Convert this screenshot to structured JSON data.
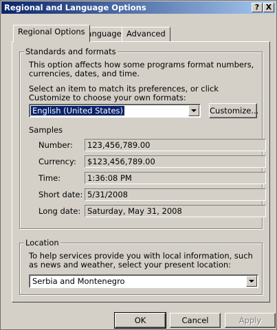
{
  "window": {
    "title": "Regional and Language Options",
    "help_label": "?",
    "close_label": "X"
  },
  "tabs": [
    {
      "label": "Regional Options",
      "active": true
    },
    {
      "label": "Languages",
      "active": false
    },
    {
      "label": "Advanced",
      "active": false
    }
  ],
  "standards": {
    "group_title": "Standards and formats",
    "description": "This option affects how some programs format numbers, currencies, dates, and time.",
    "instruction": "Select an item to match its preferences, or click Customize to choose your own formats:",
    "selected_format": "English (United States)",
    "customize_label": "Customize..."
  },
  "samples": {
    "title": "Samples",
    "rows": [
      {
        "label": "Number:",
        "value": "123,456,789.00"
      },
      {
        "label": "Currency:",
        "value": "$123,456,789.00"
      },
      {
        "label": "Time:",
        "value": "1:36:08 PM"
      },
      {
        "label": "Short date:",
        "value": "5/31/2008"
      },
      {
        "label": "Long date:",
        "value": "Saturday, May 31, 2008"
      }
    ]
  },
  "location": {
    "group_title": "Location",
    "description": "To help services provide you with local information, such as news and weather, select your present location:",
    "selected": "Serbia and Montenegro"
  },
  "footer": {
    "ok_label": "OK",
    "cancel_label": "Cancel",
    "apply_label": "Apply"
  }
}
